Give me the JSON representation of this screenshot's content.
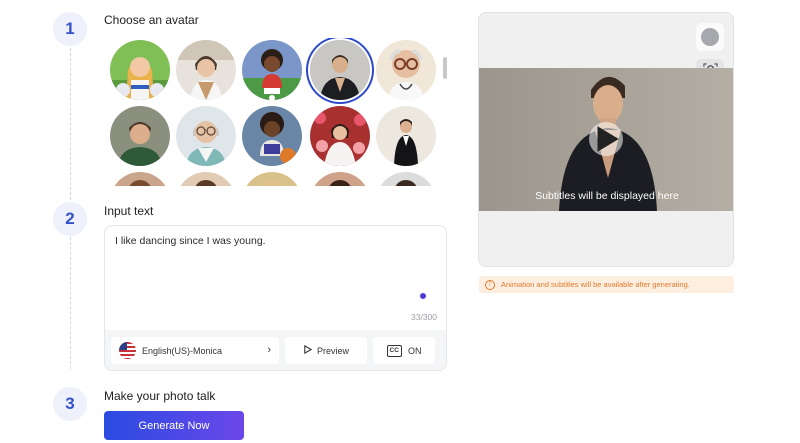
{
  "steps": [
    {
      "number": "1",
      "title": "Choose an avatar"
    },
    {
      "number": "2",
      "title": "Input text"
    },
    {
      "number": "3",
      "title": "Make your photo talk"
    }
  ],
  "colors": {
    "accent": "#2a49c9",
    "generate_start": "#2a4be0",
    "generate_end": "#6b47ea",
    "notice_text": "#e07b2d"
  },
  "avatars": [
    {
      "name": "cheerleader",
      "selected": false
    },
    {
      "name": "chef",
      "selected": false
    },
    {
      "name": "soccer-girl",
      "selected": false
    },
    {
      "name": "dancer",
      "selected": true
    },
    {
      "name": "doctor-grandpa",
      "selected": false
    },
    {
      "name": "man-green-sweater",
      "selected": false
    },
    {
      "name": "nurse",
      "selected": false
    },
    {
      "name": "basketball-girl",
      "selected": false
    },
    {
      "name": "bride",
      "selected": false
    },
    {
      "name": "groom",
      "selected": false
    }
  ],
  "text_input": {
    "value": "I like dancing since I was young.",
    "counter": "33/300"
  },
  "voice": {
    "label": "English(US)-Monica",
    "flag_icon": "us-flag-icon"
  },
  "preview_button": {
    "label": "Preview"
  },
  "cc_button": {
    "icon_text": "CC",
    "label": "ON"
  },
  "generate_button": {
    "label": "Generate Now"
  },
  "video_preview": {
    "subtitle": "Subtitles will be displayed here"
  },
  "notice": {
    "text": "Animation and subtitles will be available after generating."
  }
}
